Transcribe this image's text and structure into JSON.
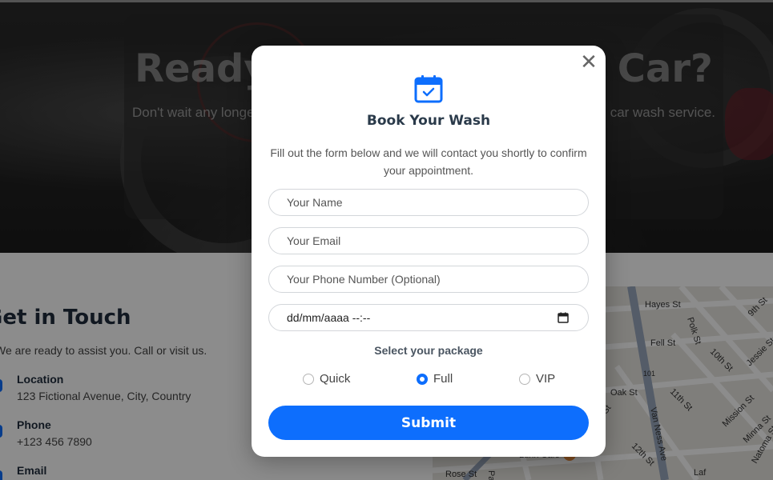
{
  "hero": {
    "title": "Ready for a Sparkling Car?",
    "subtitle": "Don't wait any longer. Book your appointment today and enjoy our professional car wash service."
  },
  "contact": {
    "title": "Get in Touch",
    "intro": "We are ready to assist you. Call or visit us.",
    "items": [
      {
        "label": "Location",
        "value": "123 Fictional Avenue, City, Country",
        "icon": "location-pin-icon"
      },
      {
        "label": "Phone",
        "value": "+123 456 7890",
        "icon": "phone-icon"
      },
      {
        "label": "Email",
        "value": "",
        "icon": "email-icon"
      }
    ]
  },
  "map": {
    "streets": [
      "Hayes St",
      "Polk St",
      "9th St",
      "Fell St",
      "10th St",
      "Jessie St",
      "Oak St",
      "11th St",
      "Mission St",
      "Market St",
      "Van Ness Ave",
      "12th St",
      "Minna St",
      "Natoma St",
      "Rose St",
      "Page St",
      "Laf",
      "Lunn Cafe",
      "101"
    ]
  },
  "modal": {
    "title": "Book Your Wash",
    "description": "Fill out the form below and we will contact you shortly to confirm your appointment.",
    "name_placeholder": "Your Name",
    "email_placeholder": "Your Email",
    "phone_placeholder": "Your Phone Number (Optional)",
    "date_value": "dd/mm/aaaa --:--",
    "package_label": "Select your package",
    "packages": [
      {
        "label": "Quick",
        "selected": false
      },
      {
        "label": "Full",
        "selected": true
      },
      {
        "label": "VIP",
        "selected": false
      }
    ],
    "submit_label": "Submit",
    "close_icon": "close-icon",
    "calendar_icon": "calendar-check-icon"
  },
  "colors": {
    "accent": "#0d6efd",
    "heading": "#2a3a4a",
    "overlay": "rgba(0,0,0,0.45)"
  }
}
